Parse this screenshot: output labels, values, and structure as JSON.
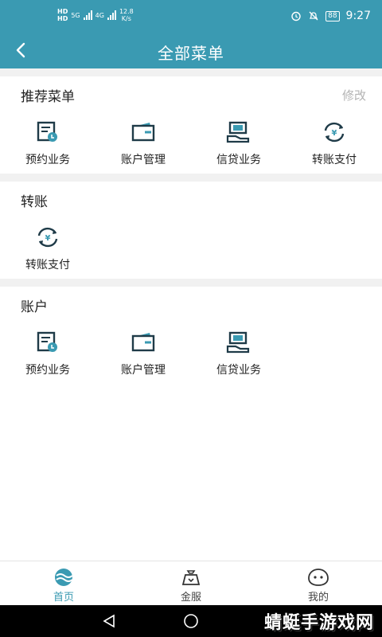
{
  "status_bar": {
    "sim1": "HD",
    "sim2": "HD",
    "network1": "5G",
    "network2": "4G",
    "speed_value": "12.8",
    "speed_unit": "K/s",
    "battery": "88",
    "time": "9:27"
  },
  "header": {
    "title": "全部菜单"
  },
  "sections": [
    {
      "title": "推荐菜单",
      "edit_label": "修改",
      "items": [
        {
          "label": "预约业务",
          "icon": "appointment-icon"
        },
        {
          "label": "账户管理",
          "icon": "wallet-icon"
        },
        {
          "label": "信贷业务",
          "icon": "loan-icon"
        },
        {
          "label": "转账支付",
          "icon": "transfer-icon"
        }
      ]
    },
    {
      "title": "转账",
      "items": [
        {
          "label": "转账支付",
          "icon": "transfer-icon"
        }
      ]
    },
    {
      "title": "账户",
      "items": [
        {
          "label": "预约业务",
          "icon": "appointment-icon"
        },
        {
          "label": "账户管理",
          "icon": "wallet-icon"
        },
        {
          "label": "信贷业务",
          "icon": "loan-icon"
        }
      ]
    }
  ],
  "tabbar": {
    "tabs": [
      {
        "label": "首页",
        "icon": "home-icon",
        "active": true
      },
      {
        "label": "金服",
        "icon": "finance-bag-icon",
        "active": false
      },
      {
        "label": "我的",
        "icon": "profile-face-icon",
        "active": false
      }
    ]
  },
  "watermark": "蜻蜓手游戏网",
  "colors": {
    "accent": "#3a9ab2",
    "icon_dark": "#1f3b48",
    "divider": "#f1f1f1"
  }
}
